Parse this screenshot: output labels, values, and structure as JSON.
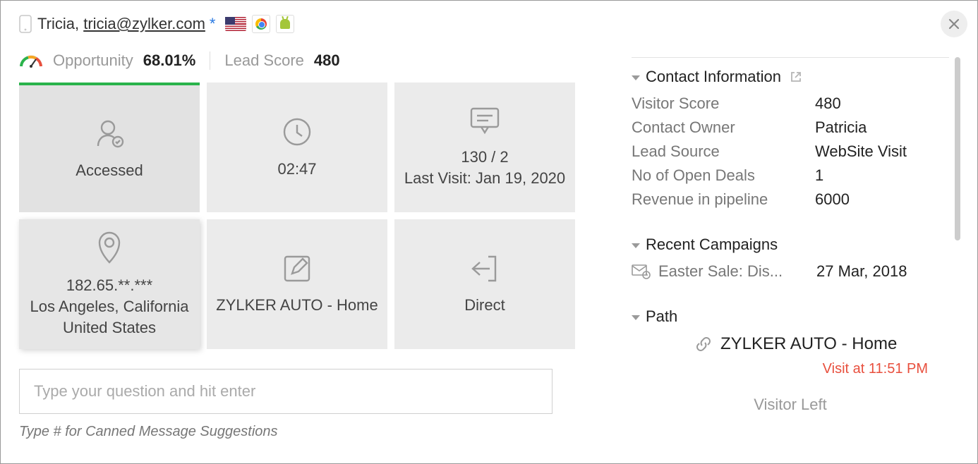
{
  "header": {
    "name": "Tricia",
    "email": "tricia@zylker.com",
    "opportunity_label": "Opportunity",
    "opportunity_value": "68.01%",
    "lead_score_label": "Lead Score",
    "lead_score_value": "480"
  },
  "tiles": [
    {
      "line1": "Accessed"
    },
    {
      "line1": "02:47"
    },
    {
      "line1": "130 / 2",
      "line2": "Last Visit: Jan 19, 2020"
    },
    {
      "line1": "182.65.**.***",
      "line2": "Los Angeles, California",
      "line3": "United States"
    },
    {
      "line1": "ZYLKER AUTO - Home"
    },
    {
      "line1": "Direct"
    }
  ],
  "chat": {
    "placeholder": "Type your question and hit enter",
    "hint": "Type # for Canned Message Suggestions"
  },
  "contact": {
    "title": "Contact Information",
    "rows": [
      {
        "k": "Visitor Score",
        "v": "480"
      },
      {
        "k": "Contact Owner",
        "v": "Patricia"
      },
      {
        "k": "Lead Source",
        "v": "WebSite Visit"
      },
      {
        "k": "No of Open Deals",
        "v": "1"
      },
      {
        "k": "Revenue in pipeline",
        "v": "6000"
      }
    ]
  },
  "campaigns": {
    "title": "Recent Campaigns",
    "items": [
      {
        "label": "Easter Sale: Dis...",
        "date": "27 Mar, 2018"
      }
    ]
  },
  "path": {
    "title": "Path",
    "page": "ZYLKER AUTO - Home",
    "visit_label": "Visit at 11:51 PM"
  },
  "visitor_left": "Visitor Left"
}
